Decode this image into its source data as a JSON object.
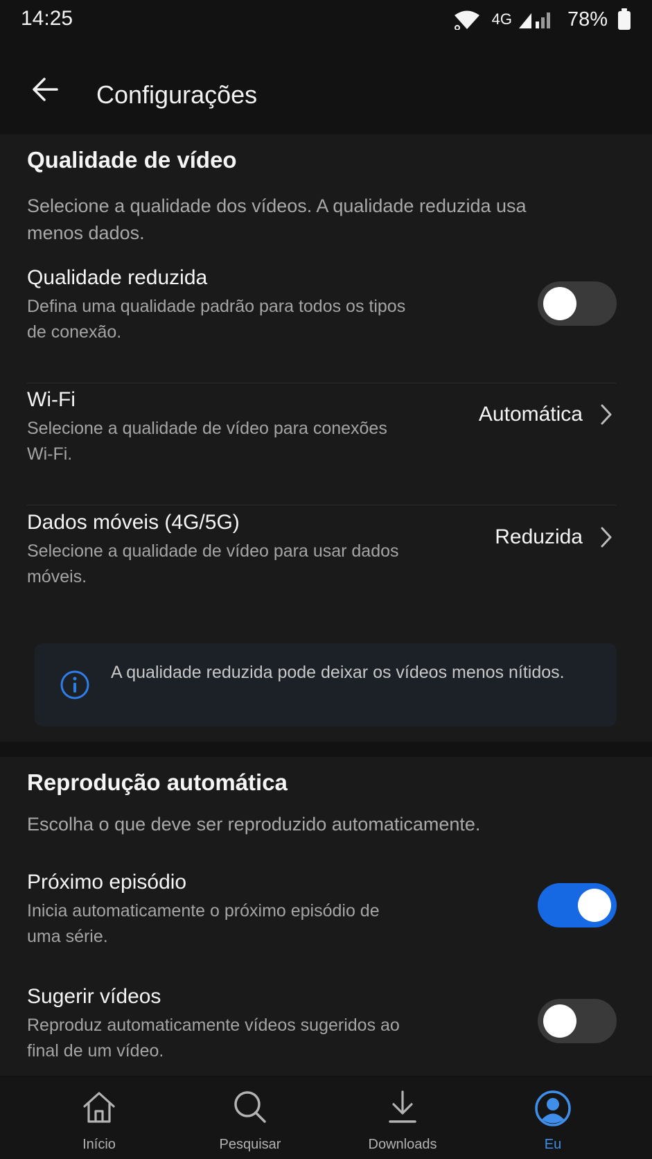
{
  "status_bar": {
    "time": "14:25",
    "network": "4G",
    "battery": "78%"
  },
  "header": {
    "title": "Configurações"
  },
  "video_quality": {
    "title": "Qualidade de vídeo",
    "description": "Selecione a qualidade dos vídeos. A qualidade reduzida usa menos dados.",
    "reduced": {
      "title": "Qualidade reduzida",
      "description": "Defina uma qualidade padrão para todos os tipos de conexão.",
      "enabled": false
    },
    "wifi": {
      "title": "Wi-Fi",
      "description": "Selecione a qualidade de vídeo para conexões Wi-Fi.",
      "value": "Automática"
    },
    "mobile": {
      "title": "Dados móveis (4G/5G)",
      "description": "Selecione a qualidade de vídeo para usar dados móveis.",
      "value": "Reduzida"
    },
    "info": "A qualidade reduzida pode deixar os vídeos menos nítidos."
  },
  "autoplay": {
    "title": "Reprodução automática",
    "description": "Escolha o que deve ser reproduzido automaticamente.",
    "next_episode": {
      "title": "Próximo episódio",
      "description": "Inicia automaticamente o próximo episódio de uma série.",
      "enabled": true
    },
    "suggest": {
      "title": "Sugerir vídeos",
      "description": "Reproduz automaticamente vídeos sugeridos ao final de um vídeo.",
      "enabled": false
    }
  },
  "nav": {
    "items": [
      {
        "label": "Início",
        "icon": "home-icon"
      },
      {
        "label": "Pesquisar",
        "icon": "search-icon"
      },
      {
        "label": "Downloads",
        "icon": "download-icon"
      },
      {
        "label": "Eu",
        "icon": "profile-icon"
      }
    ],
    "active": "Eu"
  },
  "colors": {
    "accent": "#1668e3",
    "active_nav": "#3f8fea",
    "background": "#121212",
    "card": "#1a1a1a"
  }
}
